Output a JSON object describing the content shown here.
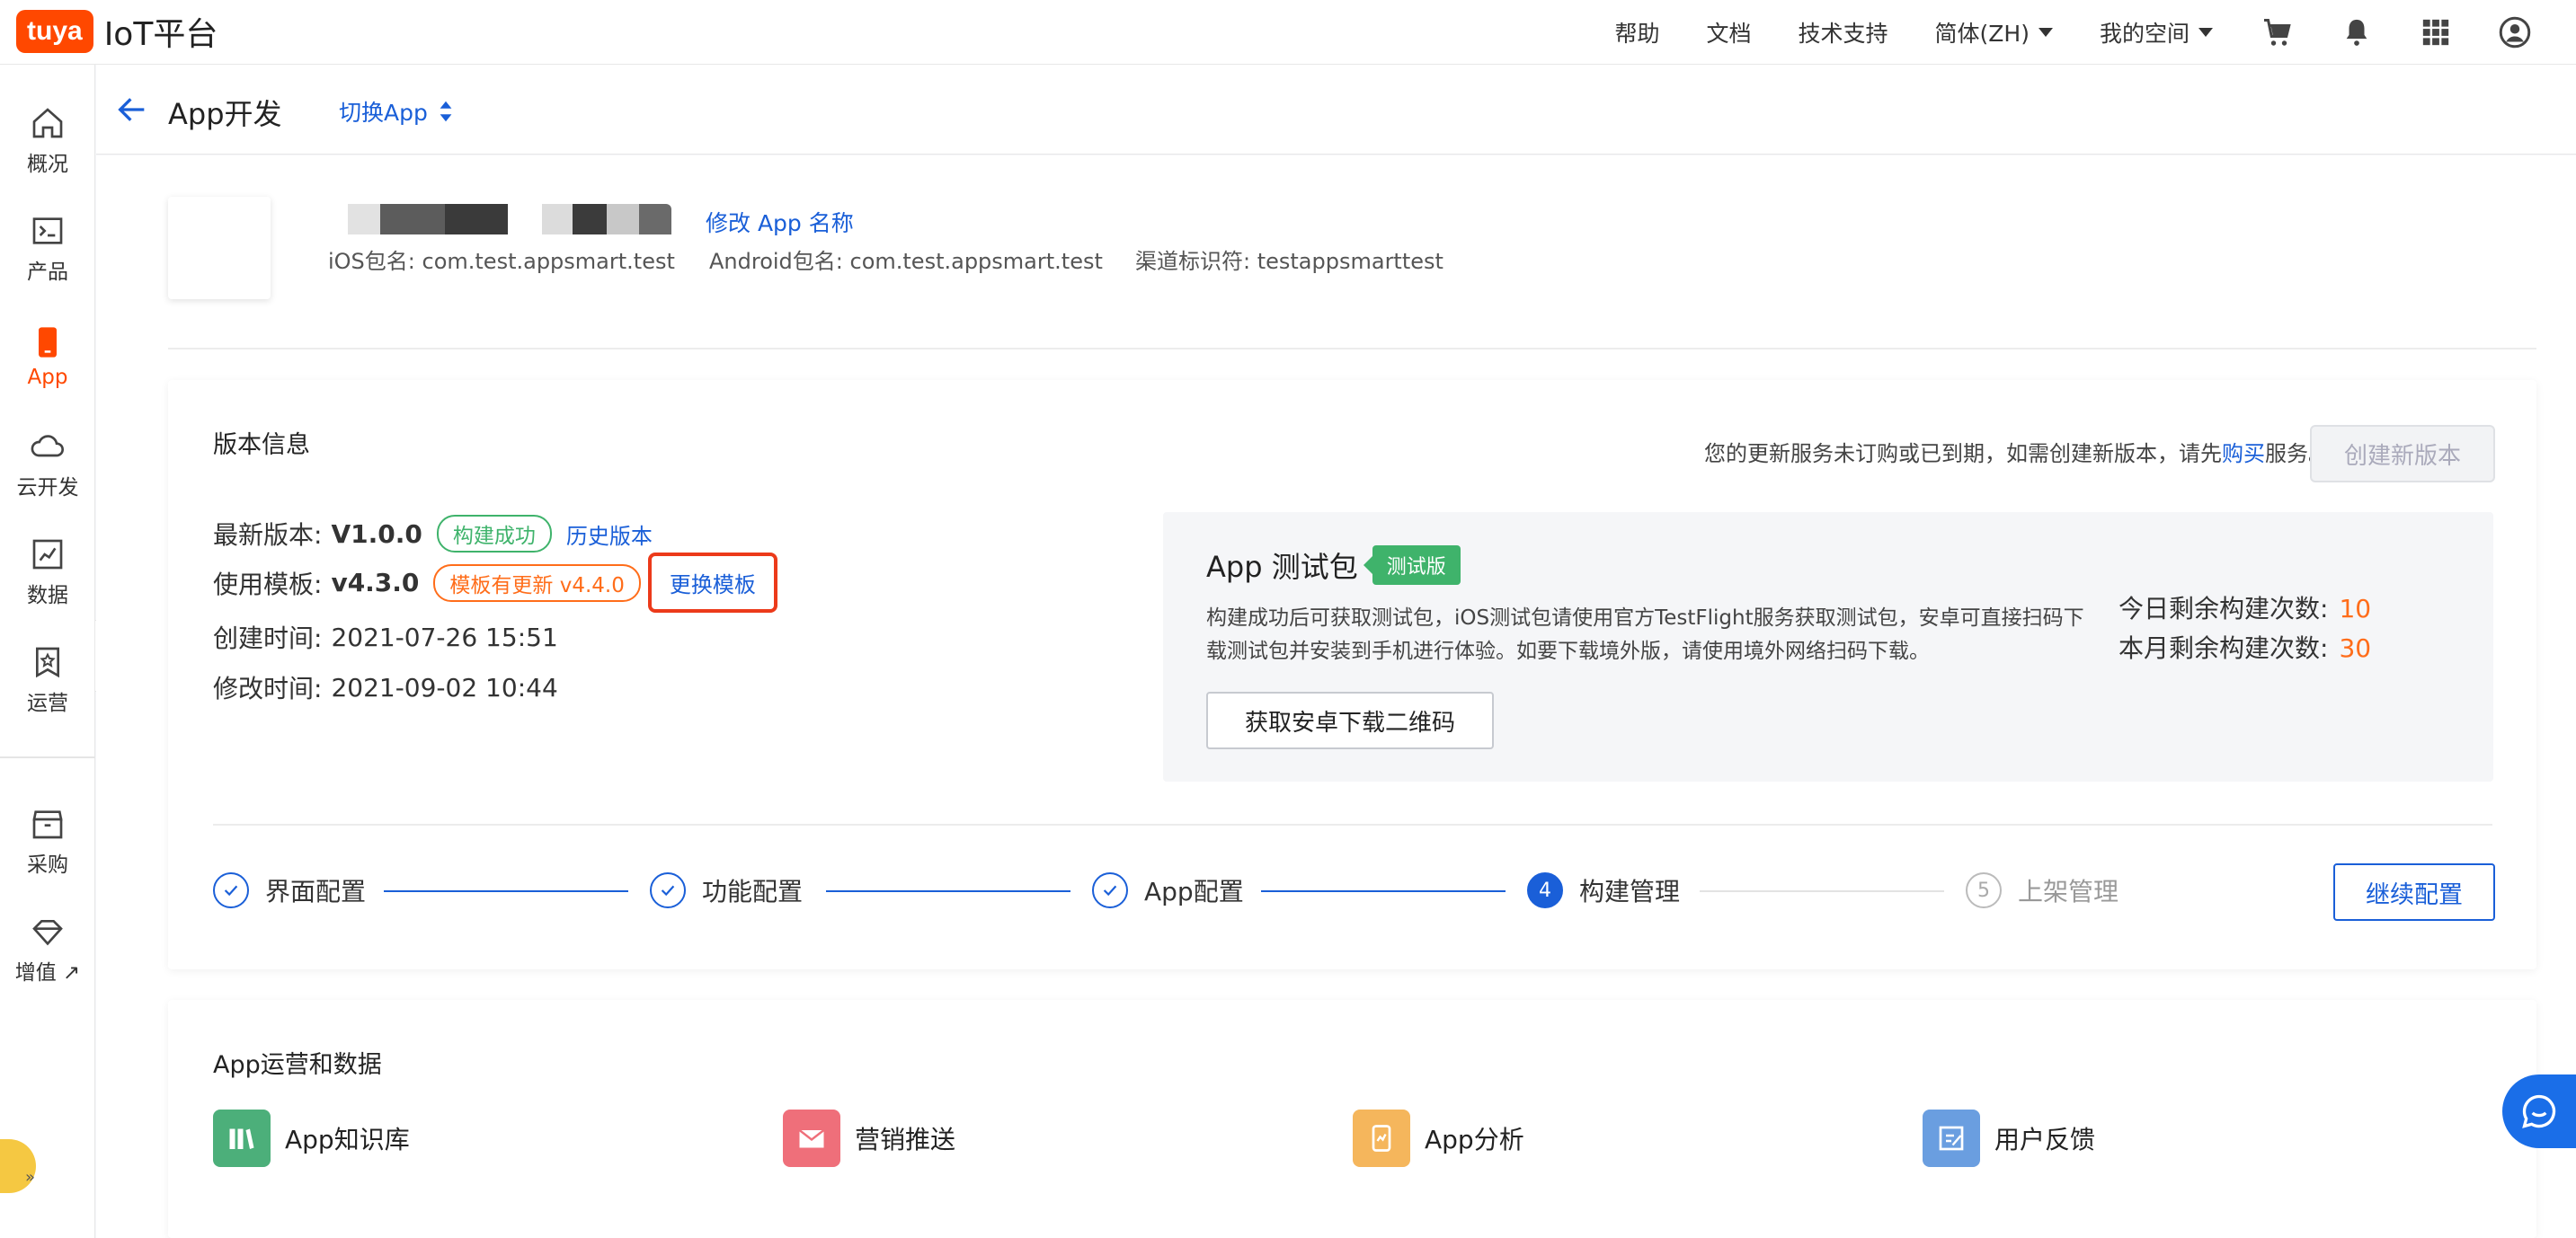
{
  "topbar": {
    "logo_brand": "tuya",
    "logo_text": "IoT平台",
    "nav": [
      "帮助",
      "文档",
      "技术支持"
    ],
    "language": "简体(ZH)",
    "space": "我的空间",
    "icons": [
      "cart-icon",
      "bell-icon",
      "grid-icon",
      "user-icon"
    ]
  },
  "sidebar": {
    "items": [
      {
        "label": "概况",
        "icon": "home-icon"
      },
      {
        "label": "产品",
        "icon": "terminal-icon"
      },
      {
        "label": "App",
        "icon": "phone-icon",
        "active": true
      },
      {
        "label": "云开发",
        "icon": "cloud-icon"
      },
      {
        "label": "数据",
        "icon": "chart-icon"
      },
      {
        "label": "运营",
        "icon": "star-icon"
      },
      {
        "label": "采购",
        "icon": "box-icon"
      },
      {
        "label": "增值",
        "icon": "diamond-icon"
      }
    ]
  },
  "header": {
    "title": "App开发",
    "switch_app": "切换App"
  },
  "app_info": {
    "rename": "修改 App 名称",
    "ios_package": "iOS包名: com.test.appsmart.test",
    "android_package": "Android包名: com.test.appsmart.test",
    "channel_id": "渠道标识符: testappsmarttest"
  },
  "version_card": {
    "title": "版本信息",
    "notice_prefix": "您的更新服务未订购或已到期，如需创建新版本，请先",
    "notice_link": "购买",
    "notice_suffix": "服务。",
    "create_button": "创建新版本",
    "latest_label": "最新版本:",
    "latest_value": "V1.0.0",
    "latest_status": "构建成功",
    "history_link": "历史版本",
    "template_label": "使用模板:",
    "template_value": "v4.3.0",
    "template_update": "模板有更新 v4.4.0",
    "change_template": "更换模板",
    "created_label": "创建时间:",
    "created_value": "2021-07-26 15:51",
    "modified_label": "修改时间:",
    "modified_value": "2021-09-02 10:44"
  },
  "test_package": {
    "title": "App 测试包",
    "badge": "测试版",
    "desc": "构建成功后可获取测试包，iOS测试包请使用官方TestFlight服务获取测试包，安卓可直接扫码下载测试包并安装到手机进行体验。如要下载境外版，请使用境外网络扫码下载。",
    "button": "获取安卓下载二维码",
    "today_label": "今日剩余构建次数:",
    "today_value": "10",
    "month_label": "本月剩余构建次数:",
    "month_value": "30"
  },
  "steps": [
    {
      "label": "界面配置",
      "state": "done"
    },
    {
      "label": "功能配置",
      "state": "done"
    },
    {
      "label": "App配置",
      "state": "done"
    },
    {
      "label": "构建管理",
      "state": "current",
      "num": "4"
    },
    {
      "label": "上架管理",
      "state": "pending",
      "num": "5"
    }
  ],
  "continue_button": "继续配置",
  "ops": {
    "title": "App运营和数据",
    "items": [
      {
        "label": "App知识库",
        "color": "#4caf7a"
      },
      {
        "label": "营销推送",
        "color": "#ef6f7a"
      },
      {
        "label": "App分析",
        "color": "#f5b65c"
      },
      {
        "label": "用户反馈",
        "color": "#6a9ee0"
      }
    ]
  },
  "colors": {
    "brand": "#ff4800",
    "link": "#1a5fd8",
    "success": "#3fb36b",
    "warning": "#ff6d1a",
    "highlight": "#ec3a1a"
  }
}
